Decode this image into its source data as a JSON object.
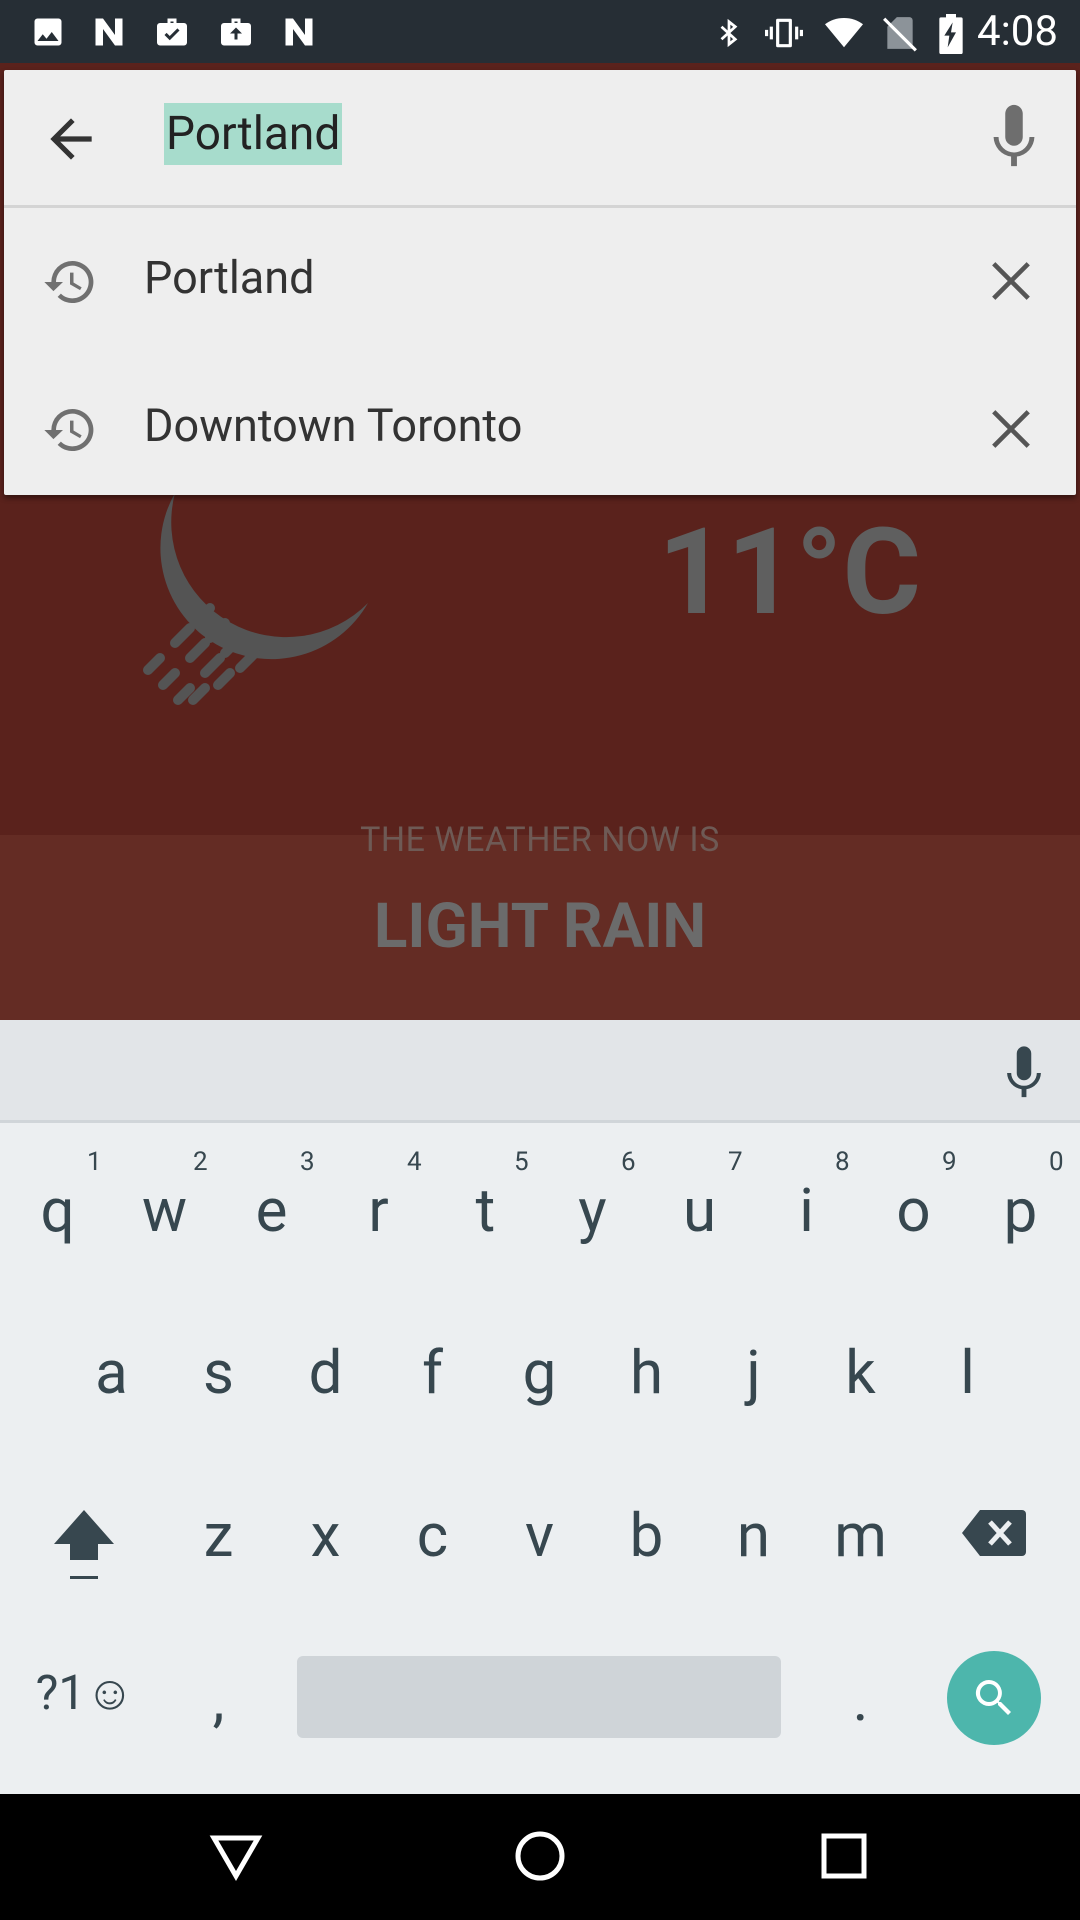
{
  "status_bar": {
    "time": "4:08",
    "left_icons": [
      "image-icon",
      "n-notification-icon",
      "briefcase-check-icon",
      "briefcase-upload-icon",
      "n-notification-icon"
    ],
    "right_icons": [
      "bluetooth-icon",
      "vibrate-icon",
      "wifi-icon",
      "no-sim-icon",
      "battery-charging-icon"
    ]
  },
  "search": {
    "query": "Portland",
    "suggestions": [
      {
        "label": "Portland"
      },
      {
        "label": "Downtown Toronto"
      }
    ]
  },
  "weather": {
    "temperature": "11°C",
    "now_label": "THE WEATHER NOW IS",
    "condition": "LIGHT RAIN",
    "icon": "moon-rain-icon"
  },
  "keyboard": {
    "row1": [
      "q",
      "w",
      "e",
      "r",
      "t",
      "y",
      "u",
      "i",
      "o",
      "p"
    ],
    "row1_hints": [
      "1",
      "2",
      "3",
      "4",
      "5",
      "6",
      "7",
      "8",
      "9",
      "0"
    ],
    "row2": [
      "a",
      "s",
      "d",
      "f",
      "g",
      "h",
      "j",
      "k",
      "l"
    ],
    "row3": [
      "z",
      "x",
      "c",
      "v",
      "b",
      "n",
      "m"
    ],
    "symbols_label": "?1☺",
    "comma": ",",
    "period": "."
  },
  "colors": {
    "status_bar": "#262e35",
    "weather_bg": "#5a221c",
    "search_card": "#eeeeee",
    "selection_highlight": "#a7dccc",
    "keyboard_bg": "#eceff1",
    "accent": "#4db6ac"
  }
}
